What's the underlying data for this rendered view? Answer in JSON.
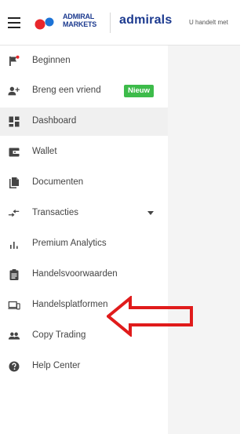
{
  "header": {
    "logo_line1": "ADMIRAL",
    "logo_line2": "MARKETS",
    "brand_word": "admirals",
    "note": "U handelt met"
  },
  "sidebar": {
    "items": [
      {
        "label": "Beginnen",
        "icon": "flag-icon"
      },
      {
        "label": "Breng een vriend",
        "icon": "add-person-icon",
        "badge": "Nieuw"
      },
      {
        "label": "Dashboard",
        "icon": "dashboard-icon",
        "active": true
      },
      {
        "label": "Wallet",
        "icon": "wallet-icon"
      },
      {
        "label": "Documenten",
        "icon": "documents-icon"
      },
      {
        "label": "Transacties",
        "icon": "transfer-arrows-icon",
        "expandable": true
      },
      {
        "label": "Premium Analytics",
        "icon": "bar-chart-icon"
      },
      {
        "label": "Handelsvoorwaarden",
        "icon": "clipboard-icon"
      },
      {
        "label": "Handelsplatformen",
        "icon": "devices-icon"
      },
      {
        "label": "Copy Trading",
        "icon": "people-icon"
      },
      {
        "label": "Help Center",
        "icon": "help-icon"
      }
    ]
  },
  "colors": {
    "brand": "#1c3a8f",
    "badge": "#3dbb4a",
    "annotation_arrow": "#e01b1b",
    "flag_dot": "#e8262b"
  }
}
